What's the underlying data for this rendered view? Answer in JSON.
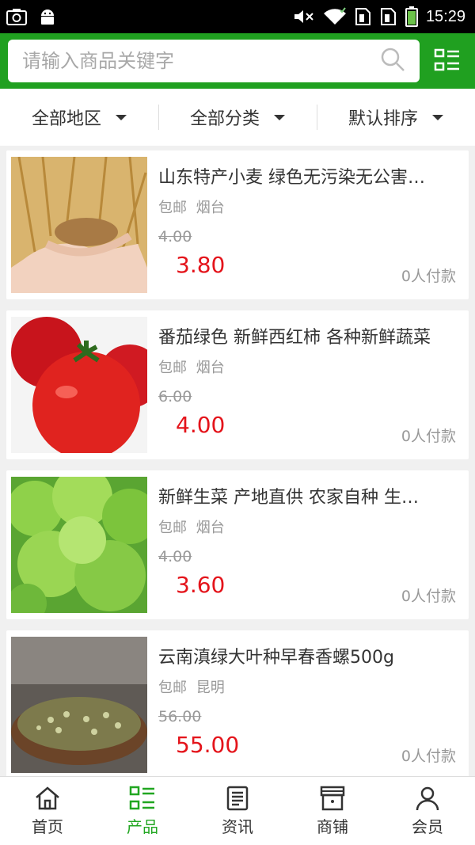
{
  "status_bar": {
    "time": "15:29",
    "icons": [
      "screenshot-icon",
      "android-icon",
      "mute-icon",
      "wifi-icon",
      "sim1-icon",
      "sim2-icon",
      "battery-icon"
    ]
  },
  "search": {
    "placeholder": "请输入商品关键字",
    "value": ""
  },
  "filters": [
    {
      "label": "全部地区"
    },
    {
      "label": "全部分类"
    },
    {
      "label": "默认排序"
    }
  ],
  "products": [
    {
      "title": "山东特产小麦 绿色无污染无公害…",
      "shipping": "包邮",
      "location": "烟台",
      "old_price": "4.00",
      "price": "3.80",
      "buyers": "0人付款",
      "image": "wheat-photo"
    },
    {
      "title": "番茄绿色 新鲜西红柿 各种新鲜蔬菜",
      "shipping": "包邮",
      "location": "烟台",
      "old_price": "6.00",
      "price": "4.00",
      "buyers": "0人付款",
      "image": "tomato-photo"
    },
    {
      "title": "新鲜生菜 产地直供 农家自种 生…",
      "shipping": "包邮",
      "location": "烟台",
      "old_price": "4.00",
      "price": "3.60",
      "buyers": "0人付款",
      "image": "lettuce-photo"
    },
    {
      "title": "云南滇绿大叶种早春香螺500g",
      "shipping": "包邮",
      "location": "昆明",
      "old_price": "56.00",
      "price": "55.00",
      "buyers": "0人付款",
      "image": "tea-photo"
    }
  ],
  "nav": [
    {
      "label": "首页",
      "icon": "home-icon",
      "active": false
    },
    {
      "label": "产品",
      "icon": "products-icon",
      "active": true
    },
    {
      "label": "资讯",
      "icon": "news-icon",
      "active": false
    },
    {
      "label": "商铺",
      "icon": "shop-icon",
      "active": false
    },
    {
      "label": "会员",
      "icon": "member-icon",
      "active": false
    }
  ],
  "colors": {
    "brand_green": "#20a020",
    "price_red": "#e4141b",
    "active_nav": "#21a621"
  }
}
